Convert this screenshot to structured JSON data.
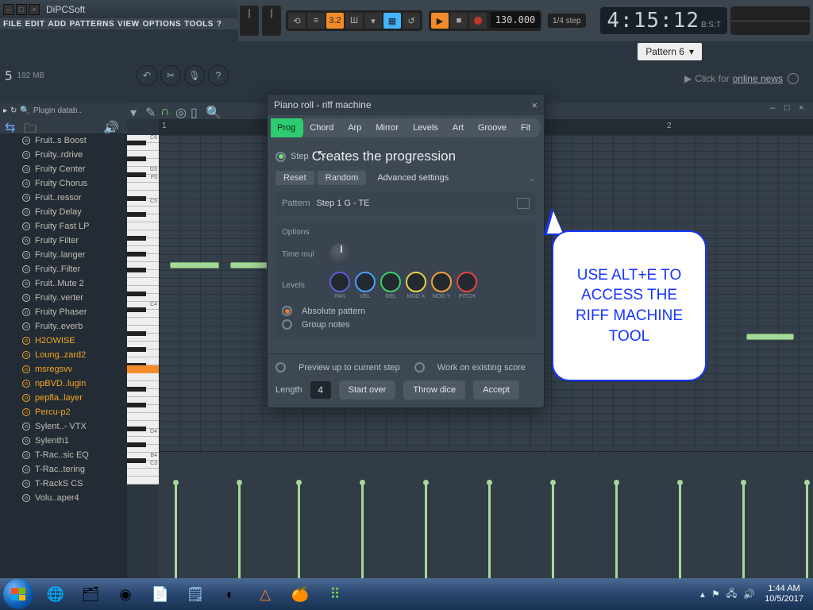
{
  "app": {
    "title": "DiPCSoft"
  },
  "menu": [
    "FILE",
    "EDIT",
    "ADD",
    "PATTERNS",
    "VIEW",
    "OPTIONS",
    "TOOLS",
    "?"
  ],
  "transport": {
    "tempo": "130.000",
    "step_mode": "1/4 step",
    "pattern_selector": "Pattern 6",
    "time_display": {
      "bars": "4:15",
      "ticks": ":12",
      "label": "B:S:T"
    }
  },
  "news": {
    "prefix": "Click for",
    "link": "online news"
  },
  "leftinfo": {
    "count": "5",
    "mem": "192 MB"
  },
  "browser": {
    "header": "Plugin datab..",
    "items": [
      {
        "t": "Fruit..s Boost",
        "o": false
      },
      {
        "t": "Fruity..rdrive",
        "o": false
      },
      {
        "t": "Fruity Center",
        "o": false
      },
      {
        "t": "Fruity Chorus",
        "o": false
      },
      {
        "t": "Fruit..ressor",
        "o": false
      },
      {
        "t": "Fruity Delay",
        "o": false
      },
      {
        "t": "Fruity Fast LP",
        "o": false
      },
      {
        "t": "Fruity Filter",
        "o": false
      },
      {
        "t": "Fruity..langer",
        "o": false
      },
      {
        "t": "Fruity..Filter",
        "o": false
      },
      {
        "t": "Fruit..Mute 2",
        "o": false
      },
      {
        "t": "Fruity..verter",
        "o": false
      },
      {
        "t": "Fruity Phaser",
        "o": false
      },
      {
        "t": "Fruity..everb",
        "o": false
      },
      {
        "t": "H2OWISE",
        "o": true
      },
      {
        "t": "Loung..zard2",
        "o": true
      },
      {
        "t": "msregsvv",
        "o": true
      },
      {
        "t": "npBVD..lugin",
        "o": true
      },
      {
        "t": "pepfla..layer",
        "o": true
      },
      {
        "t": "Percu-p2",
        "o": true
      },
      {
        "t": "Sylent..- VTX",
        "o": false
      },
      {
        "t": "Sylenth1",
        "o": false
      },
      {
        "t": "T-Rac..sic EQ",
        "o": false
      },
      {
        "t": "T-Rac..tering",
        "o": false
      },
      {
        "t": "T-RackS CS",
        "o": false
      },
      {
        "t": "Volu..aper4",
        "o": false
      }
    ]
  },
  "ruler": {
    "m1": "1",
    "m2": "2"
  },
  "dialog": {
    "title": "Piano roll - riff machine",
    "tabs": [
      "Prog",
      "Chord",
      "Arp",
      "Mirror",
      "Levels",
      "Art",
      "Groove",
      "Fit"
    ],
    "step_label": "Step",
    "heading": "Creates the progression",
    "reset": "Reset",
    "random": "Random",
    "advanced": "Advanced settings",
    "pattern_label": "Pattern",
    "pattern_value": "Step 1 G - TE",
    "options_title": "Options",
    "time_mul": "Time mul",
    "levels_label": "Levels",
    "level_knobs": [
      {
        "cap": "PAN",
        "c": "#5d5dd6"
      },
      {
        "cap": "VEL",
        "c": "#4aa0ff"
      },
      {
        "cap": "REL",
        "c": "#3dcf6a"
      },
      {
        "cap": "MOD X",
        "c": "#e5d24a"
      },
      {
        "cap": "MOD Y",
        "c": "#f4a13a"
      },
      {
        "cap": "PITCH",
        "c": "#e3473f"
      }
    ],
    "absolute": "Absolute pattern",
    "group": "Group notes",
    "preview": "Preview up to current step",
    "work": "Work on existing score",
    "length_label": "Length",
    "length_value": "4",
    "start_over": "Start over",
    "throw_dice": "Throw dice",
    "accept": "Accept"
  },
  "callout": {
    "text": "USE ALT+E TO ACCESS THE RIFF MACHINE TOOL"
  },
  "clock": {
    "time": "1:44 AM",
    "date": "10/5/2017"
  },
  "keylabels": [
    "C6",
    "",
    "",
    "",
    "G5",
    "F5",
    "",
    "",
    "C5",
    "",
    "",
    "",
    "",
    "",
    "",
    "",
    "",
    "",
    "",
    "",
    "",
    "C4",
    "",
    "",
    "",
    "",
    "",
    "",
    "",
    "",
    "",
    "",
    "",
    "",
    "",
    "",
    "",
    "D4",
    "",
    "",
    "B4",
    "C3"
  ]
}
